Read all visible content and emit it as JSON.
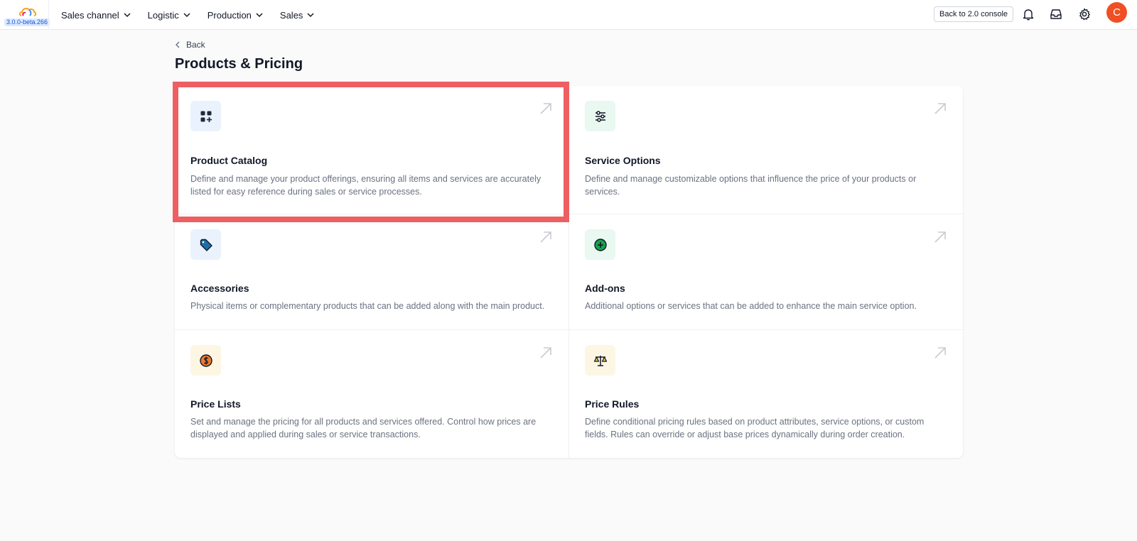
{
  "header": {
    "version": "3.0.0-beta.266",
    "nav": [
      {
        "label": "Sales channel"
      },
      {
        "label": "Logistic"
      },
      {
        "label": "Production"
      },
      {
        "label": "Sales"
      }
    ],
    "console_button": "Back to 2.0 console",
    "avatar_initial": "C"
  },
  "page": {
    "back_label": "Back",
    "title": "Products & Pricing"
  },
  "cards": [
    {
      "title": "Product Catalog",
      "description": "Define and manage your product offerings, ensuring all items and services are accurately listed for easy reference during sales or service processes.",
      "icon": "catalog-grid-icon",
      "color": "#eaf2fd"
    },
    {
      "title": "Service Options",
      "description": "Define and manage customizable options that influence the price of your products or services.",
      "icon": "sliders-icon",
      "color": "#e9f8f1"
    },
    {
      "title": "Accessories",
      "description": "Physical items or complementary products that can be added along with the main product.",
      "icon": "tag-icon",
      "color": "#eaf2fd"
    },
    {
      "title": "Add-ons",
      "description": "Additional options or services that can be added to enhance the main service option.",
      "icon": "plus-circle-icon",
      "color": "#e9f8f1"
    },
    {
      "title": "Price Lists",
      "description": "Set and manage the pricing for all products and services offered. Control how prices are displayed and applied during sales or service transactions.",
      "icon": "dollar-coin-icon",
      "color": "#fdf6e3"
    },
    {
      "title": "Price Rules",
      "description": "Define conditional pricing rules based on product attributes, service options, or custom fields. Rules can override or adjust base prices dynamically during order creation.",
      "icon": "scales-icon",
      "color": "#fdf6e3"
    }
  ],
  "highlight_color": "#ee5f62"
}
